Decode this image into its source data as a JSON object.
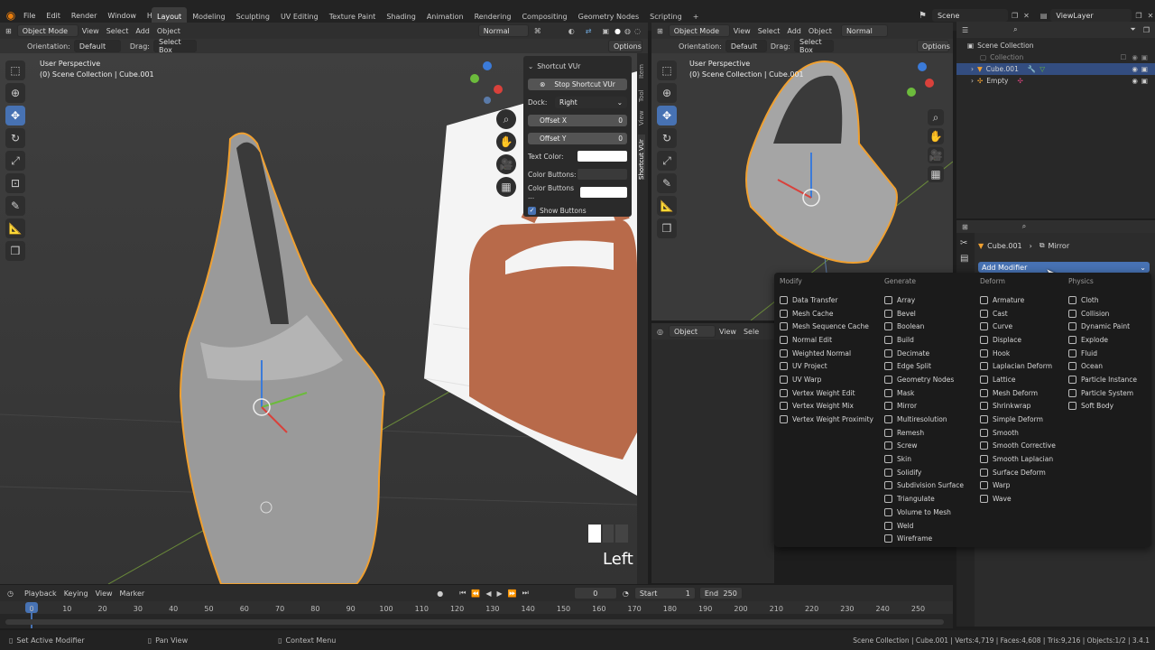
{
  "menubar": {
    "items": [
      "File",
      "Edit",
      "Render",
      "Window",
      "Help"
    ],
    "workspaces": [
      "Layout",
      "Modeling",
      "Sculpting",
      "UV Editing",
      "Texture Paint",
      "Shading",
      "Animation",
      "Rendering",
      "Compositing",
      "Geometry Nodes",
      "Scripting"
    ],
    "add_tab": "+",
    "scene": "Scene",
    "view_layer": "ViewLayer"
  },
  "left_viewport": {
    "mode": "Object Mode",
    "menus": [
      "View",
      "Select",
      "Add",
      "Object"
    ],
    "orientation_label": "Orientation:",
    "orientation_value": "Default",
    "drag_label": "Drag:",
    "drag_value": "Select Box",
    "shading": "Normal",
    "options": "Options",
    "info_line1": "User Perspective",
    "info_line2": "(0) Scene Collection | Cube.001",
    "key_overlay": "Left",
    "side_tabs": [
      "Item",
      "Tool",
      "View",
      "Shortcut VUr"
    ]
  },
  "npanel": {
    "title": "Shortcut VUr",
    "stop_button": "Stop Shortcut VUr",
    "dock_label": "Dock:",
    "dock_value": "Right",
    "offset_x_label": "Offset X",
    "offset_x_value": "0",
    "offset_y_label": "Offset Y",
    "offset_y_value": "0",
    "text_color_label": "Text Color:",
    "color_buttons_label": "Color Buttons:",
    "color_buttons2_label": "Color Buttons ...",
    "show_buttons_label": "Show Buttons"
  },
  "right_viewport": {
    "mode": "Object Mode",
    "menus": [
      "View",
      "Select",
      "Add",
      "Object"
    ],
    "orientation_label": "Orientation:",
    "orientation_value": "Default",
    "drag_label": "Drag:",
    "drag_value": "Select Box",
    "shading": "Normal",
    "options": "Options",
    "info_line1": "User Perspective",
    "info_line2": "(0) Scene Collection | Cube.001"
  },
  "lower_editor": {
    "mode": "Object",
    "menus": [
      "View",
      "Sele"
    ]
  },
  "outliner": {
    "root": "Scene Collection",
    "items": [
      "Collection",
      "Cube.001",
      "Empty"
    ]
  },
  "properties": {
    "object": "Cube.001",
    "modifier": "Mirror",
    "add_modifier": "Add Modifier"
  },
  "modifier_menu": {
    "columns": [
      {
        "title": "Modify",
        "items": [
          "Data Transfer",
          "Mesh Cache",
          "Mesh Sequence Cache",
          "Normal Edit",
          "Weighted Normal",
          "UV Project",
          "UV Warp",
          "Vertex Weight Edit",
          "Vertex Weight Mix",
          "Vertex Weight Proximity"
        ]
      },
      {
        "title": "Generate",
        "items": [
          "Array",
          "Bevel",
          "Boolean",
          "Build",
          "Decimate",
          "Edge Split",
          "Geometry Nodes",
          "Mask",
          "Mirror",
          "Multiresolution",
          "Remesh",
          "Screw",
          "Skin",
          "Solidify",
          "Subdivision Surface",
          "Triangulate",
          "Volume to Mesh",
          "Weld",
          "Wireframe"
        ]
      },
      {
        "title": "Deform",
        "items": [
          "Armature",
          "Cast",
          "Curve",
          "Displace",
          "Hook",
          "Laplacian Deform",
          "Lattice",
          "Mesh Deform",
          "Shrinkwrap",
          "Simple Deform",
          "Smooth",
          "Smooth Corrective",
          "Smooth Laplacian",
          "Surface Deform",
          "Warp",
          "Wave"
        ]
      },
      {
        "title": "Physics",
        "items": [
          "Cloth",
          "Collision",
          "Dynamic Paint",
          "Explode",
          "Fluid",
          "Ocean",
          "Particle Instance",
          "Particle System",
          "Soft Body"
        ]
      }
    ]
  },
  "timeline": {
    "menus": [
      "Playback",
      "Keying",
      "View",
      "Marker"
    ],
    "current_frame": "0",
    "start_label": "Start",
    "start_value": "1",
    "end_label": "End",
    "end_value": "250",
    "ticks": [
      "0",
      "10",
      "20",
      "30",
      "40",
      "50",
      "60",
      "70",
      "80",
      "90",
      "100",
      "110",
      "120",
      "130",
      "140",
      "150",
      "160",
      "170",
      "180",
      "190",
      "200",
      "210",
      "220",
      "230",
      "240",
      "250"
    ]
  },
  "statusbar": {
    "left": "Set Active Modifier",
    "middle": "Pan View",
    "context": "Context Menu",
    "stats": "Scene Collection | Cube.001 | Verts:4,719 | Faces:4,608 | Tris:9,216 | Objects:1/2 | 3.4.1"
  },
  "colors": {
    "accent": "#4772b3",
    "selection_outline": "#f0a030",
    "bag_leather": "#b86a4a"
  }
}
